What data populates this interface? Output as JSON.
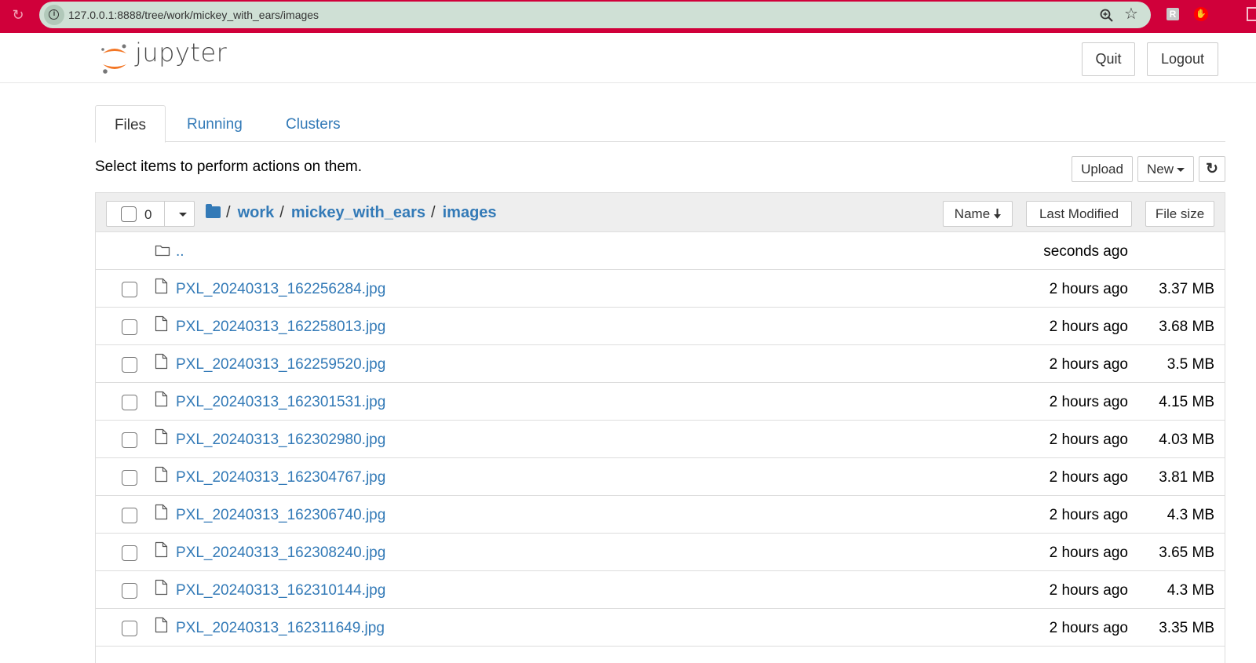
{
  "browser": {
    "url": "127.0.0.1:8888/tree/work/mickey_with_ears/images",
    "toolbar_color": "#d0003a"
  },
  "header": {
    "logo_text": "jupyter",
    "quit_label": "Quit",
    "logout_label": "Logout"
  },
  "tabs": [
    {
      "label": "Files",
      "active": true
    },
    {
      "label": "Running",
      "active": false
    },
    {
      "label": "Clusters",
      "active": false
    }
  ],
  "instructions": "Select items to perform actions on them.",
  "toolbar": {
    "upload_label": "Upload",
    "new_label": "New",
    "refresh_icon": "refresh-icon"
  },
  "list_header": {
    "selected_count": "0",
    "breadcrumb": [
      "work",
      "mickey_with_ears",
      "images"
    ],
    "sort_name_label": "Name",
    "sort_modified_label": "Last Modified",
    "sort_size_label": "File size"
  },
  "parent_dir": {
    "name": "..",
    "modified": "seconds ago"
  },
  "files": [
    {
      "name": "PXL_20240313_162256284.jpg",
      "modified": "2 hours ago",
      "size": "3.37 MB"
    },
    {
      "name": "PXL_20240313_162258013.jpg",
      "modified": "2 hours ago",
      "size": "3.68 MB"
    },
    {
      "name": "PXL_20240313_162259520.jpg",
      "modified": "2 hours ago",
      "size": "3.5 MB"
    },
    {
      "name": "PXL_20240313_162301531.jpg",
      "modified": "2 hours ago",
      "size": "4.15 MB"
    },
    {
      "name": "PXL_20240313_162302980.jpg",
      "modified": "2 hours ago",
      "size": "4.03 MB"
    },
    {
      "name": "PXL_20240313_162304767.jpg",
      "modified": "2 hours ago",
      "size": "3.81 MB"
    },
    {
      "name": "PXL_20240313_162306740.jpg",
      "modified": "2 hours ago",
      "size": "4.3 MB"
    },
    {
      "name": "PXL_20240313_162308240.jpg",
      "modified": "2 hours ago",
      "size": "3.65 MB"
    },
    {
      "name": "PXL_20240313_162310144.jpg",
      "modified": "2 hours ago",
      "size": "4.3 MB"
    },
    {
      "name": "PXL_20240313_162311649.jpg",
      "modified": "2 hours ago",
      "size": "3.35 MB"
    }
  ],
  "colors": {
    "link": "#337ab7",
    "logo_orange": "#f37726",
    "logo_gray": "#767677"
  }
}
